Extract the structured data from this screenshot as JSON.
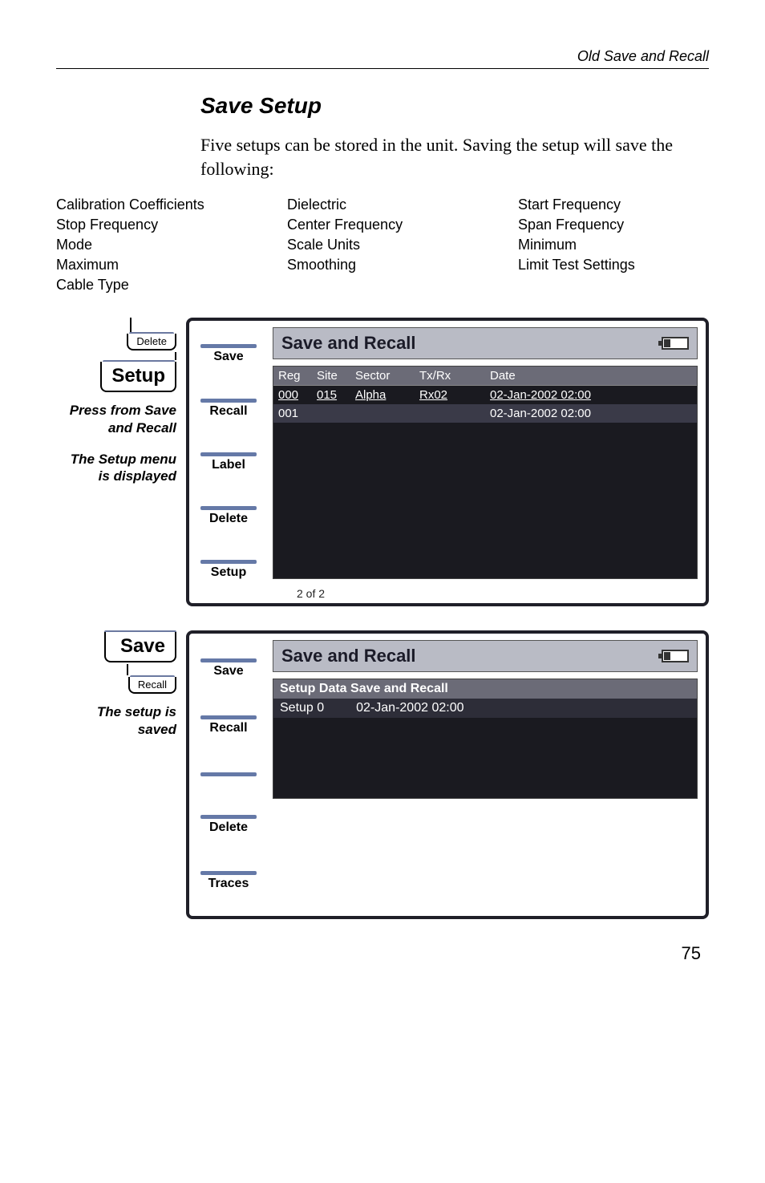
{
  "header": {
    "running_head": "Old Save and Recall"
  },
  "section": {
    "title": "Save Setup",
    "intro": "Five setups can be stored in the unit. Saving the setup will save the following:"
  },
  "save_items": {
    "col1": [
      "Calibration Coefficients",
      "Stop Frequency",
      "Mode",
      "Maximum",
      "Cable Type"
    ],
    "col2": [
      "Dielectric",
      "Center Frequency",
      "Scale Units",
      "Smoothing"
    ],
    "col3": [
      "Start Frequency",
      "Span Frequency",
      "Minimum",
      "Limit Test Settings"
    ]
  },
  "fig1": {
    "left": {
      "top_tab": "Delete",
      "main_tab": "Setup",
      "caption1": "Press from Save and Recall",
      "caption2": "The Setup menu is displayed"
    },
    "softkeys": [
      "Save",
      "Recall",
      "Label",
      "Delete",
      "Setup"
    ],
    "title": "Save and Recall",
    "table": {
      "headers": {
        "reg": "Reg",
        "site": "Site",
        "sector": "Sector",
        "txrx": "Tx/Rx",
        "date": "Date"
      },
      "rows": [
        {
          "reg": "000",
          "site": "015",
          "sector": "Alpha",
          "txrx": "Rx02",
          "date": "02-Jan-2002 02:00"
        },
        {
          "reg": "001",
          "site": "",
          "sector": "",
          "txrx": "",
          "date": "02-Jan-2002 02:00"
        }
      ]
    },
    "pager": "2 of 2"
  },
  "fig2": {
    "left": {
      "main_tab": "Save",
      "sub_tab": "Recall",
      "caption": "The setup is saved"
    },
    "softkeys": [
      "Save",
      "Recall",
      "",
      "Delete",
      "Traces"
    ],
    "title": "Save and Recall",
    "panel": {
      "header": "Setup Data Save and Recall",
      "row": {
        "name": "Setup 0",
        "date": "02-Jan-2002 02:00"
      }
    }
  },
  "page_number": "75"
}
